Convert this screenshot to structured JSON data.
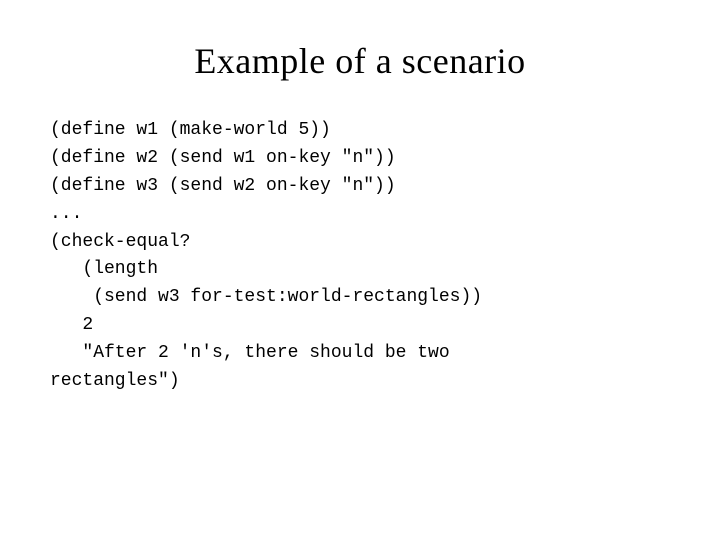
{
  "slide": {
    "title": "Example of a scenario",
    "code": "(define w1 (make-world 5))\n(define w2 (send w1 on-key \"n\"))\n(define w3 (send w2 on-key \"n\"))\n...\n(check-equal?\n   (length\n    (send w3 for-test:world-rectangles))\n   2\n   \"After 2 'n's, there should be two\nrectangles\")"
  }
}
